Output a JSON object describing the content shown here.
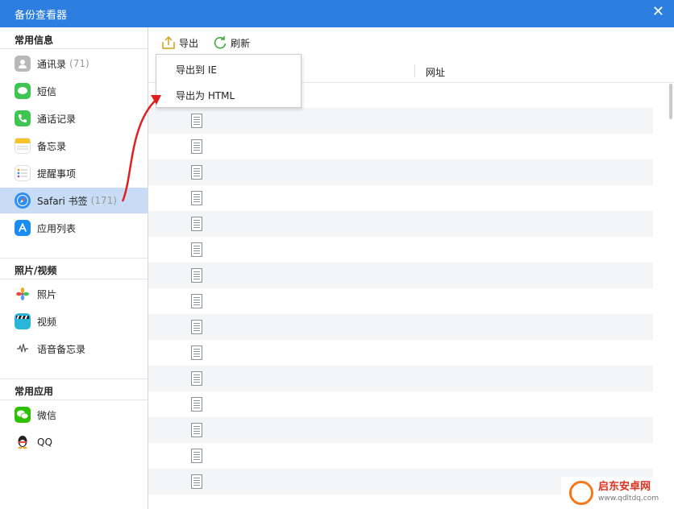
{
  "window": {
    "title": "备份查看器",
    "close_glyph": "✕"
  },
  "sidebar": {
    "groups": [
      {
        "header": "常用信息",
        "items": [
          {
            "label": "通讯录",
            "count": "(71)",
            "icon": "contacts-icon",
            "color": "#b9b9b9"
          },
          {
            "label": "短信",
            "count": "",
            "icon": "messages-icon",
            "color": "#3ec651"
          },
          {
            "label": "通话记录",
            "count": "",
            "icon": "phone-icon",
            "color": "#3ec651"
          },
          {
            "label": "备忘录",
            "count": "",
            "icon": "notes-icon",
            "color": "#f7c325"
          },
          {
            "label": "提醒事项",
            "count": "",
            "icon": "reminders-icon",
            "color": "#e8e8e8"
          },
          {
            "label": "Safari 书签",
            "count": "(171)",
            "icon": "safari-icon",
            "color": "#2f8ff5",
            "selected": true
          },
          {
            "label": "应用列表",
            "count": "",
            "icon": "appstore-icon",
            "color": "#1a8cf4"
          }
        ]
      },
      {
        "header": "照片/视频",
        "items": [
          {
            "label": "照片",
            "count": "",
            "icon": "photos-icon",
            "color": "#f5a623"
          },
          {
            "label": "视频",
            "count": "",
            "icon": "video-icon",
            "color": "#2bb5d8"
          },
          {
            "label": "语音备忘录",
            "count": "",
            "icon": "voice-memo-icon",
            "color": "#555555"
          }
        ]
      },
      {
        "header": "常用应用",
        "items": [
          {
            "label": "微信",
            "count": "",
            "icon": "wechat-icon",
            "color": "#2dc100"
          },
          {
            "label": "QQ",
            "count": "",
            "icon": "qq-icon",
            "color": "#222222"
          }
        ]
      }
    ]
  },
  "toolbar": {
    "export_label": "导出",
    "refresh_label": "刷新"
  },
  "table": {
    "columns": [
      "网址"
    ],
    "row_count": 16
  },
  "export_menu": {
    "items": [
      "导出到 IE",
      "导出为 HTML"
    ]
  },
  "watermark": {
    "main": "启东安卓网",
    "sub": "www.qdltdq.com"
  },
  "colors": {
    "accent": "#2c7ee0",
    "selected_bg": "#c9dcf5",
    "arrow": "#e02020"
  }
}
